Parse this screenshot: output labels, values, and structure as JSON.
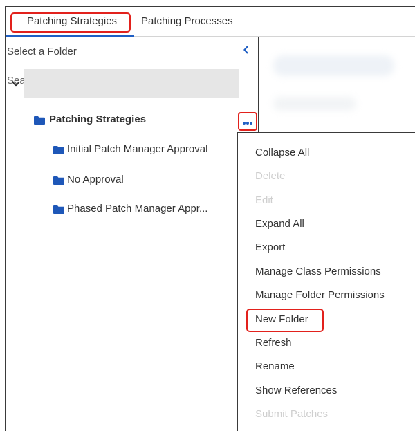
{
  "tabs": [
    {
      "label": "Patching Strategies",
      "selected": true
    },
    {
      "label": "Patching Processes",
      "selected": false
    }
  ],
  "folder_pane": {
    "title": "Select a Folder",
    "collapse_icon": "chevron-left-icon",
    "search_placeholder": "Search..."
  },
  "tree": {
    "root": {
      "label": "Patching Strategies",
      "expanded": true
    },
    "children": [
      {
        "label": "Initial Patch Manager Approval"
      },
      {
        "label": "No Approval"
      },
      {
        "label": "Phased Patch Manager Appr..."
      }
    ]
  },
  "context_menu": {
    "items": [
      {
        "label": "Collapse All",
        "enabled": true
      },
      {
        "label": "Delete",
        "enabled": false
      },
      {
        "label": "Edit",
        "enabled": false
      },
      {
        "label": "Expand All",
        "enabled": true
      },
      {
        "label": "Export",
        "enabled": true
      },
      {
        "label": "Manage Class Permissions",
        "enabled": true
      },
      {
        "label": "Manage Folder Permissions",
        "enabled": true
      },
      {
        "label": "New Folder",
        "enabled": true,
        "highlighted": true
      },
      {
        "label": "Refresh",
        "enabled": true
      },
      {
        "label": "Rename",
        "enabled": true
      },
      {
        "label": "Show References",
        "enabled": true
      },
      {
        "label": "Submit Patches",
        "enabled": false
      }
    ]
  },
  "colors": {
    "accent_blue": "#1f5fc4",
    "highlight_red": "#e2211c",
    "folder_blue": "#1e57b8",
    "selected_row": "#e6e6e6",
    "disabled_text": "#cfcfcf"
  }
}
